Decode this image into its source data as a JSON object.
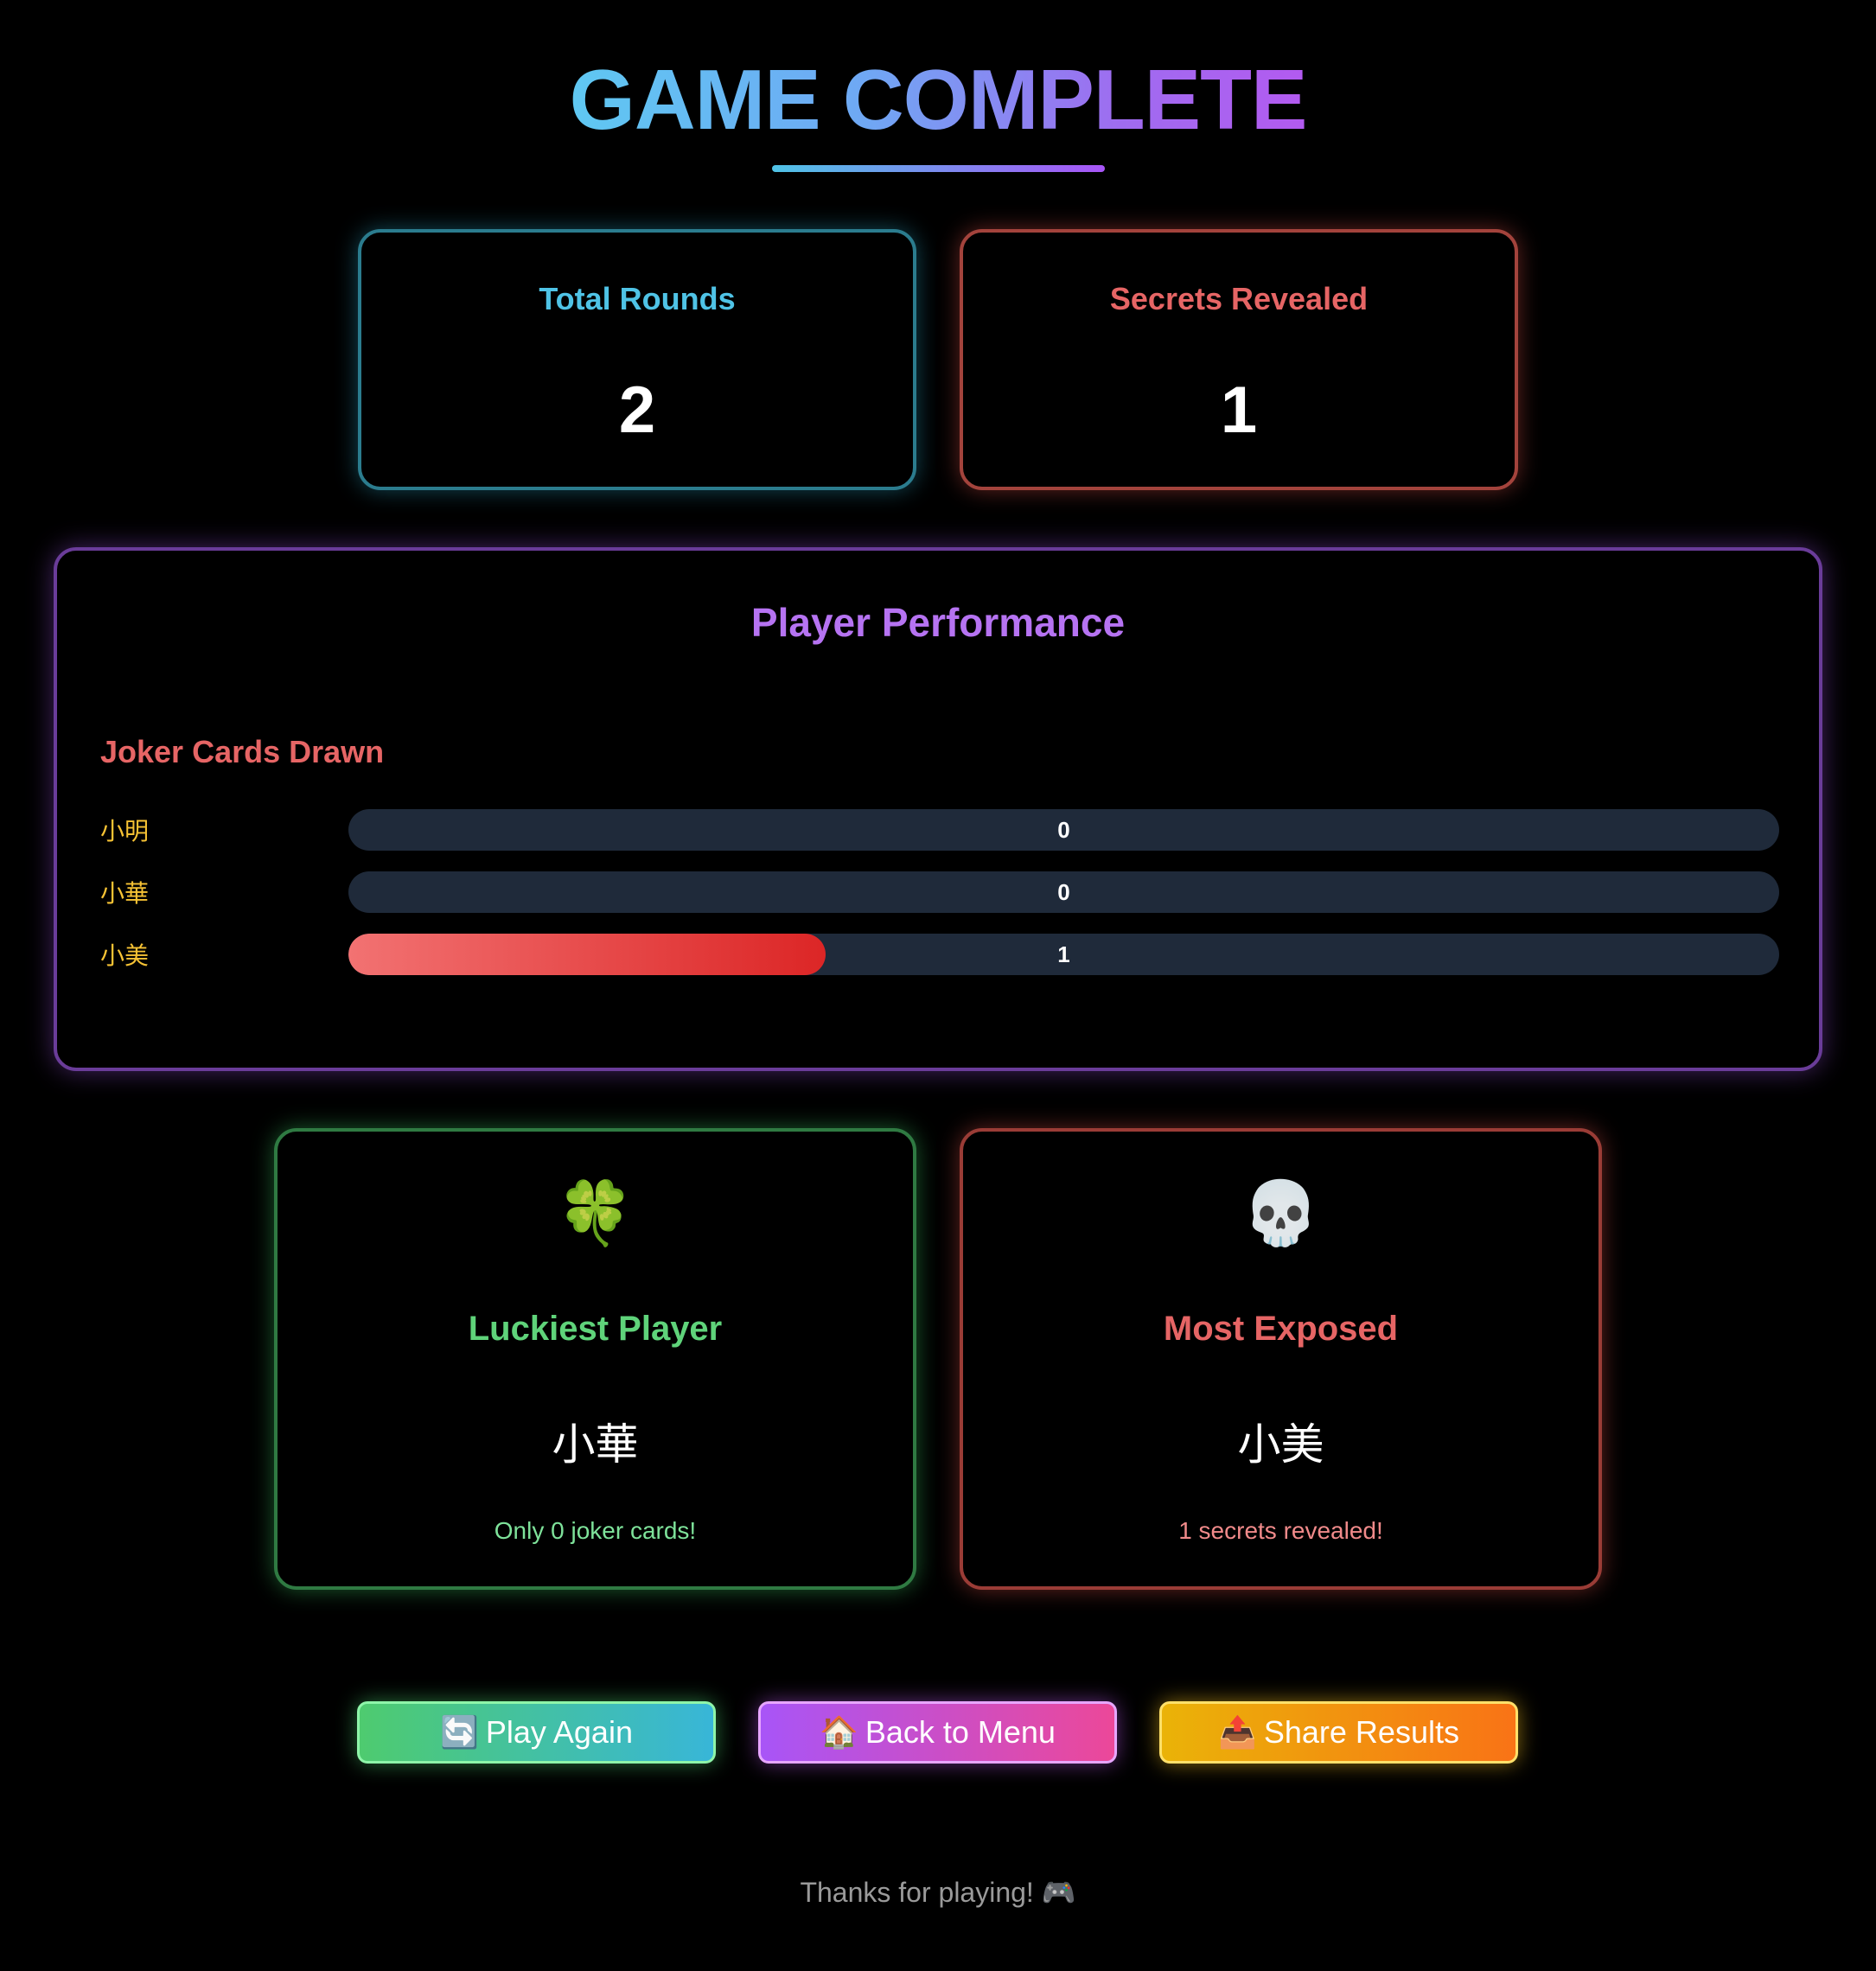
{
  "header": {
    "title": "GAME COMPLETE"
  },
  "stats": {
    "total_rounds_label": "Total Rounds",
    "total_rounds_value": "2",
    "secrets_revealed_label": "Secrets Revealed",
    "secrets_revealed_value": "1"
  },
  "performance": {
    "title": "Player Performance",
    "subtitle": "Joker Cards Drawn",
    "max": 3,
    "players": [
      {
        "name": "小明",
        "value": 0,
        "label": "0"
      },
      {
        "name": "小華",
        "value": 0,
        "label": "0"
      },
      {
        "name": "小美",
        "value": 1,
        "label": "1"
      }
    ]
  },
  "awards": {
    "lucky": {
      "icon": "four-leaf-clover-icon",
      "glyph": "🍀",
      "title": "Luckiest Player",
      "name": "小華",
      "note": "Only 0 joker cards!"
    },
    "exposed": {
      "icon": "skull-icon",
      "glyph": "💀",
      "title": "Most Exposed",
      "name": "小美",
      "note": "1 secrets revealed!"
    }
  },
  "buttons": {
    "play_again": {
      "icon": "refresh-icon",
      "glyph": "🔄",
      "label": "Play Again"
    },
    "back_to_menu": {
      "icon": "house-icon",
      "glyph": "🏠",
      "label": "Back to Menu"
    },
    "share_results": {
      "icon": "outbox-tray-icon",
      "glyph": "📤",
      "label": "Share Results"
    }
  },
  "footer": {
    "text": "Thanks for playing! 🎮"
  },
  "colors": {
    "rounds_accent": "#4fc3e6",
    "secrets_accent": "#e66565",
    "performance_accent": "#b673f2",
    "lucky_accent": "#5fd37a",
    "exposed_accent": "#e66565",
    "player_name": "#f6c234"
  }
}
